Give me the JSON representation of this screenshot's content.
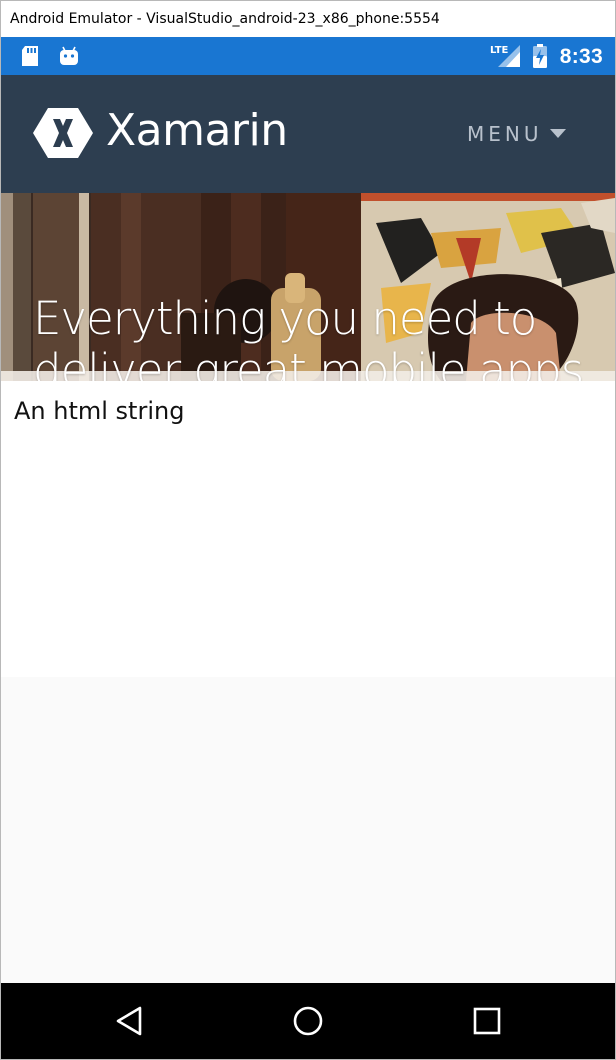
{
  "window": {
    "title": "Android Emulator - VisualStudio_android-23_x86_phone:5554"
  },
  "status_bar": {
    "left_icons": [
      "sd-card-icon",
      "android-icon"
    ],
    "network_label": "LTE",
    "right_icons": [
      "signal-icon",
      "battery-charging-icon"
    ],
    "time": "8:33",
    "color": "#1976d2"
  },
  "site": {
    "brand": "Xamarin",
    "menu_label": "MENU",
    "header_color": "#2d3e50",
    "hero_heading_line1": "Everything you need to",
    "hero_heading_line2": "deliver great mobile apps"
  },
  "content": {
    "label": "An html string"
  },
  "nav_bar": {
    "buttons": [
      "back-icon",
      "home-icon",
      "recents-icon"
    ]
  }
}
